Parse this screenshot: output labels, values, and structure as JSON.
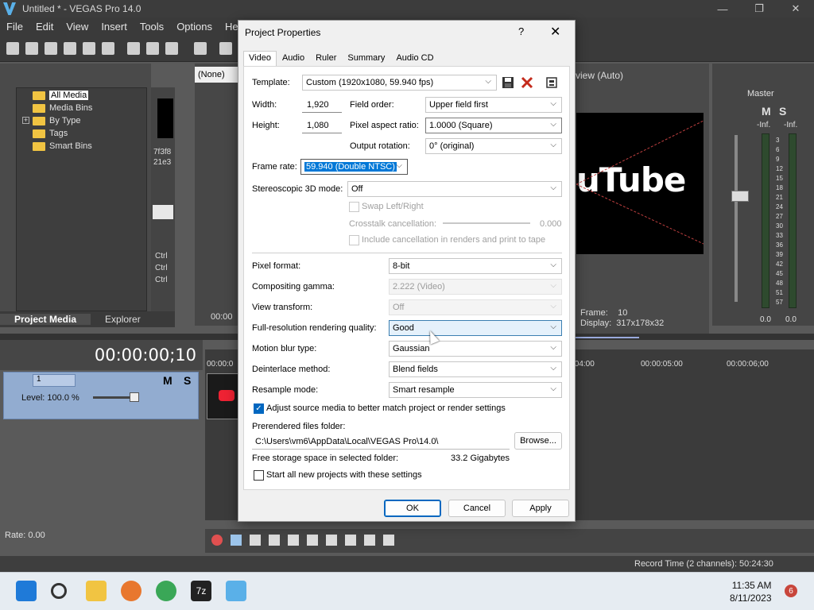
{
  "window": {
    "title": "Untitled * - VEGAS Pro 14.0",
    "minimize": "—",
    "restore": "❐",
    "close": "✕"
  },
  "menu": [
    "File",
    "Edit",
    "View",
    "Insert",
    "Tools",
    "Options",
    "Help"
  ],
  "media_panel": {
    "tree": [
      {
        "label": "All Media",
        "selected": true
      },
      {
        "label": "Media Bins"
      },
      {
        "label": "By Type",
        "expander": "+"
      },
      {
        "label": "Tags"
      },
      {
        "label": "Smart Bins"
      }
    ],
    "tabs": [
      "Project Media",
      "Explorer"
    ],
    "thumb_caption_1": "7f3f8",
    "thumb_caption_2": "21e3",
    "ctrl_labels": [
      "Ctrl",
      "Ctrl",
      "Ctrl"
    ]
  },
  "trimmer": {
    "selector": "(None)",
    "time": "00:00"
  },
  "preview": {
    "quality": "view (Auto)",
    "video_text": "uTube",
    "frame_label": "Frame:",
    "frame_value": "10",
    "display_label": "Display:",
    "display_value": "317x178x32"
  },
  "master": {
    "label": "Master",
    "m": "M",
    "s": "S",
    "inf_left": "-Inf.",
    "inf_right": "-Inf.",
    "scale": [
      "3",
      "6",
      "9",
      "12",
      "15",
      "18",
      "21",
      "24",
      "27",
      "30",
      "33",
      "36",
      "39",
      "42",
      "45",
      "48",
      "51",
      "57"
    ],
    "bottom_left": "0.0",
    "bottom_right": "0.0"
  },
  "timeline": {
    "timecode": "00:00:00;10",
    "track_number": "1",
    "level": "Level: 100.0 %",
    "m": "M",
    "s": "S",
    "ruler": [
      "00:00:0",
      ":04:00",
      "00:00:05:00",
      "00:00:06;00"
    ],
    "rate": "Rate: 0.00"
  },
  "status": {
    "record_time": "Record Time (2 channels): 50:24:30"
  },
  "taskbar": {
    "time": "11:35 AM",
    "date": "8/11/2023",
    "notifications": "6",
    "app_icon_label": "7z"
  },
  "dialog": {
    "title": "Project Properties",
    "help": "?",
    "close": "✕",
    "tabs": [
      "Video",
      "Audio",
      "Ruler",
      "Summary",
      "Audio CD"
    ],
    "template_label": "Template:",
    "template_value": "Custom (1920x1080, 59.940 fps)",
    "width_label": "Width:",
    "width_value": "1,920",
    "height_label": "Height:",
    "height_value": "1,080",
    "field_order_label": "Field order:",
    "field_order_value": "Upper field first",
    "par_label": "Pixel aspect ratio:",
    "par_value": "1.0000 (Square)",
    "rotation_label": "Output rotation:",
    "rotation_value": "0° (original)",
    "frame_rate_label": "Frame rate:",
    "frame_rate_value": "59.940 (Double NTSC)",
    "stereo_label": "Stereoscopic 3D mode:",
    "stereo_value": "Off",
    "swap_label": "Swap Left/Right",
    "crosstalk_label": "Crosstalk cancellation:",
    "crosstalk_value": "0.000",
    "include_cancel_label": "Include cancellation in renders and print to tape",
    "pixel_format_label": "Pixel format:",
    "pixel_format_value": "8-bit",
    "gamma_label": "Compositing gamma:",
    "gamma_value": "2.222 (Video)",
    "view_transform_label": "View transform:",
    "view_transform_value": "Off",
    "render_quality_label": "Full-resolution rendering quality:",
    "render_quality_value": "Good",
    "motion_blur_label": "Motion blur type:",
    "motion_blur_value": "Gaussian",
    "deinterlace_label": "Deinterlace method:",
    "deinterlace_value": "Blend fields",
    "resample_label": "Resample mode:",
    "resample_value": "Smart resample",
    "adjust_label": "Adjust source media to better match project or render settings",
    "prerender_label": "Prerendered files folder:",
    "prerender_value": "C:\\Users\\vm6\\AppData\\Local\\VEGAS Pro\\14.0\\",
    "browse": "Browse...",
    "free_storage_label": "Free storage space in selected folder:",
    "free_storage_value": "33.2 Gigabytes",
    "start_all_label": "Start all new projects with these settings",
    "ok": "OK",
    "cancel": "Cancel",
    "apply": "Apply"
  },
  "colors": {
    "accent": "#0067c0",
    "folder": "#f1c442",
    "track": "#92acd0"
  }
}
